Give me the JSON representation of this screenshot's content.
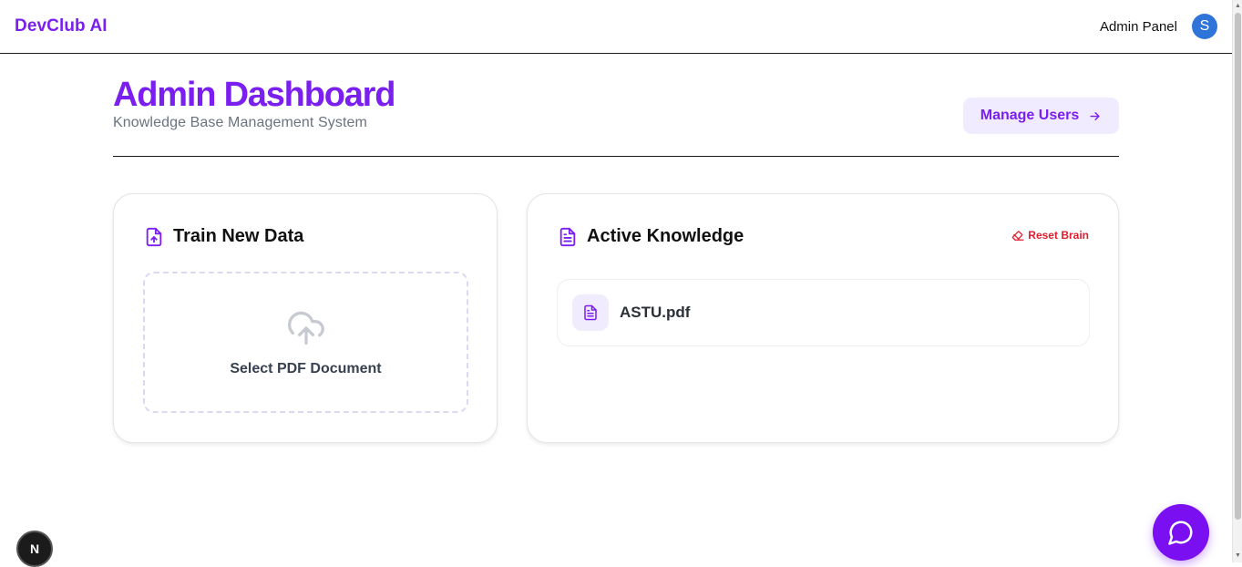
{
  "topbar": {
    "brand": "DevClub AI",
    "admin_panel": "Admin Panel",
    "avatar_initial": "S"
  },
  "header": {
    "title": "Admin Dashboard",
    "subtitle": "Knowledge Base Management System",
    "manage_users_label": "Manage Users"
  },
  "train_card": {
    "title": "Train New Data",
    "dropzone_label": "Select PDF Document"
  },
  "knowledge_card": {
    "title": "Active Knowledge",
    "reset_label": "Reset Brain",
    "files": [
      {
        "name": "ASTU.pdf"
      }
    ]
  },
  "badge": {
    "letter": "N"
  },
  "colors": {
    "accent": "#7a1ff0",
    "danger": "#e11d2e",
    "avatar": "#2f74d8"
  }
}
